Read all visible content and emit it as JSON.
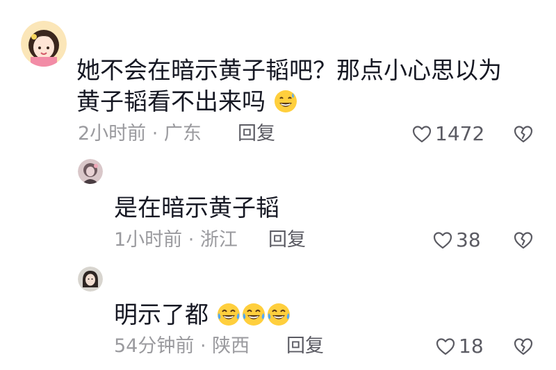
{
  "comments": [
    {
      "text_line1": "她不会在暗示黄子韬吧？那点小心思以为",
      "text_line2": "黄子韬看不出来吗",
      "meta": "2小时前 · 广东",
      "reply_label": "回复",
      "likes": "1472",
      "emojis": [
        "grin-sweat-icon"
      ]
    },
    {
      "text": "是在暗示黄子韬",
      "meta": "1小时前 · 浙江",
      "reply_label": "回复",
      "likes": "38"
    },
    {
      "text": "明示了都",
      "meta": "54分钟前 · 陕西",
      "reply_label": "回复",
      "likes": "18",
      "emojis": [
        "laugh-cry-icon",
        "laugh-cry-icon",
        "laugh-cry-icon"
      ]
    }
  ],
  "colors": {
    "text": "#161823",
    "meta": "#9a9a9e",
    "action": "#5b5b63",
    "emoji_face": "#ffcf3d",
    "emoji_tear": "#4fa8ff"
  }
}
